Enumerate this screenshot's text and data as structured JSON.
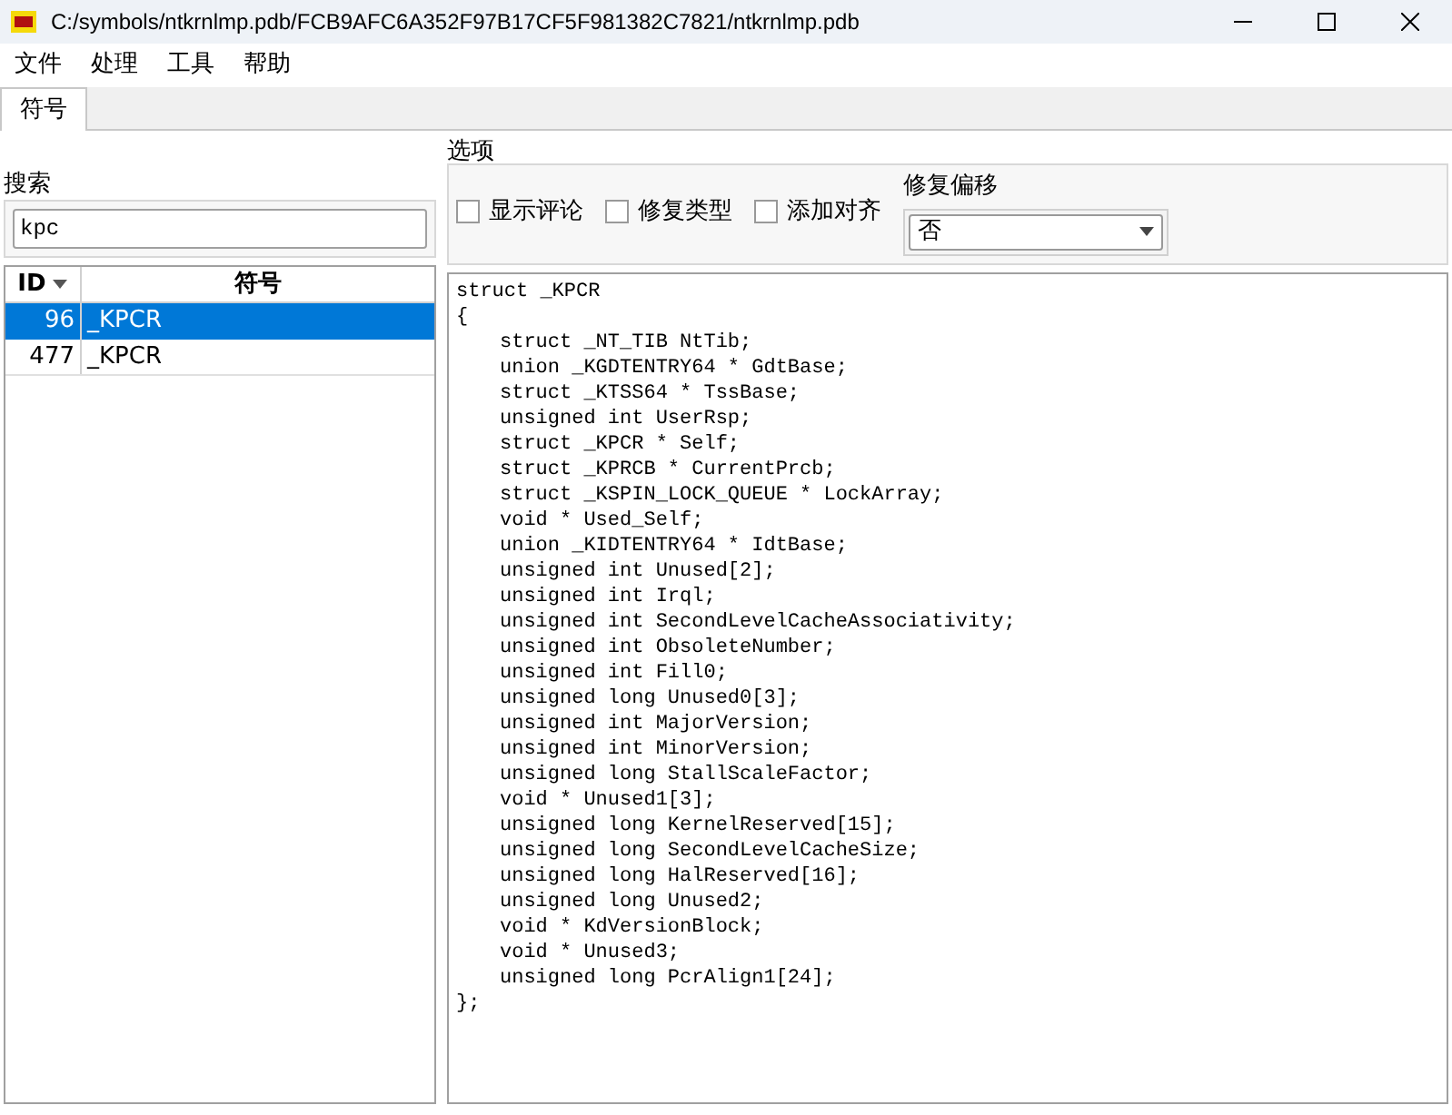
{
  "window": {
    "title": "C:/symbols/ntkrnlmp.pdb/FCB9AFC6A352F97B17CF5F981382C7821/ntkrnlmp.pdb"
  },
  "menu": [
    "文件",
    "处理",
    "工具",
    "帮助"
  ],
  "tabs": [
    {
      "label": "符号",
      "selected": true
    }
  ],
  "search": {
    "title": "搜索",
    "value": "kpc"
  },
  "table": {
    "columns": [
      "ID",
      "符号"
    ],
    "rows": [
      {
        "cells": [
          "96",
          "_KPCR"
        ],
        "selected": true
      },
      {
        "cells": [
          "477",
          "_KPCR"
        ],
        "selected": false
      }
    ]
  },
  "options": {
    "title": "选项",
    "checkboxes": [
      {
        "label": "显示评论",
        "checked": false
      },
      {
        "label": "修复类型",
        "checked": false
      },
      {
        "label": "添加对齐",
        "checked": false
      }
    ],
    "fix_offset": {
      "label": "修复偏移",
      "value": "否"
    }
  },
  "code": {
    "header": "struct _KPCR",
    "open": "{",
    "members": [
      "struct _NT_TIB NtTib;",
      "union _KGDTENTRY64 * GdtBase;",
      "struct _KTSS64 * TssBase;",
      "unsigned int UserRsp;",
      "struct _KPCR * Self;",
      "struct _KPRCB * CurrentPrcb;",
      "struct _KSPIN_LOCK_QUEUE * LockArray;",
      "void * Used_Self;",
      "union _KIDTENTRY64 * IdtBase;",
      "unsigned int Unused[2];",
      "unsigned int Irql;",
      "unsigned int SecondLevelCacheAssociativity;",
      "unsigned int ObsoleteNumber;",
      "unsigned int Fill0;",
      "unsigned long Unused0[3];",
      "unsigned int MajorVersion;",
      "unsigned int MinorVersion;",
      "unsigned long StallScaleFactor;",
      "void * Unused1[3];",
      "unsigned long KernelReserved[15];",
      "unsigned long SecondLevelCacheSize;",
      "unsigned long HalReserved[16];",
      "unsigned long Unused2;",
      "void * KdVersionBlock;",
      "void * Unused3;",
      "unsigned long PcrAlign1[24];"
    ],
    "close": "};"
  }
}
